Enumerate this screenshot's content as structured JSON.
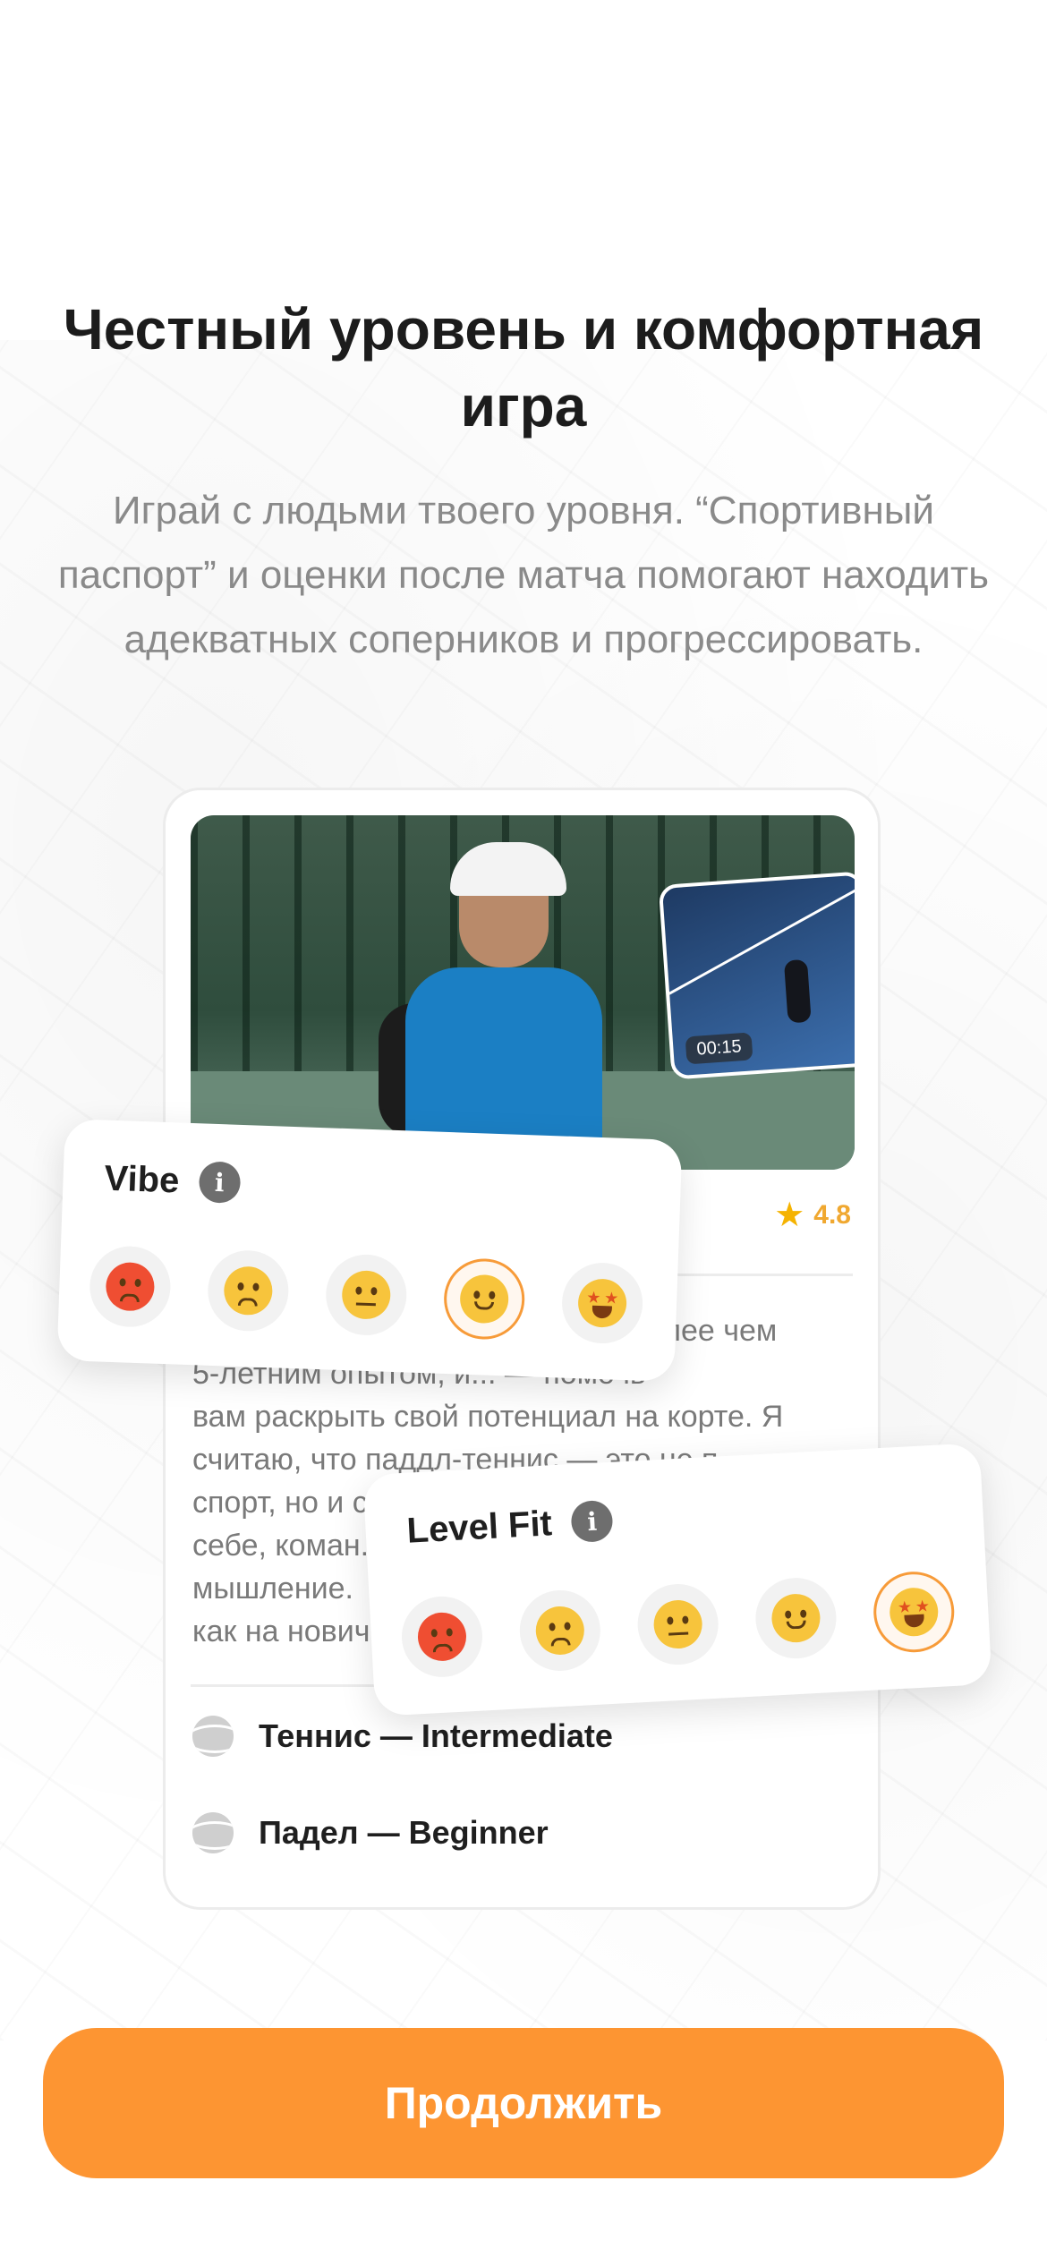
{
  "onboarding": {
    "title": "Честный уровень и комфортная игра",
    "subtitle": "Играй с людьми твоего уровня. “Спортивный паспорт” и оценки после матча помогают находить адекватных соперников и прогрессировать."
  },
  "profile_card": {
    "video_time": "00:15",
    "rating": "4.8",
    "bio_lines": [
      "олее чем",
      "5-летним опытом, и... — помочь",
      "вам раскрыть свой потенциал на корте. Я",
      "считаю, что паддл-теннис — это не п...",
      "спорт, но и с...",
      "себе, коман...",
      "мышление.",
      "как на нович..."
    ],
    "sports": [
      {
        "label": "Теннис — Intermediate",
        "icon": "tennis-ball-icon"
      },
      {
        "label": "Падел — Beginner",
        "icon": "padel-ball-icon"
      }
    ]
  },
  "vibe_card": {
    "title": "Vibe",
    "info_glyph": "i",
    "selected_index": 3,
    "options": [
      "angry-face-icon",
      "frowning-face-icon",
      "neutral-face-icon",
      "slightly-smiling-face-icon",
      "star-struck-face-icon"
    ]
  },
  "level_fit_card": {
    "title": "Level Fit",
    "info_glyph": "i",
    "selected_index": 4,
    "options": [
      "angry-face-icon",
      "frowning-face-icon",
      "neutral-face-icon",
      "slightly-smiling-face-icon",
      "star-struck-face-icon"
    ]
  },
  "cta": {
    "label": "Продолжить",
    "color": "#fd9532"
  },
  "colors": {
    "accent": "#fd9532",
    "rating": "#f0a830",
    "selected_ring": "#f79b39"
  }
}
